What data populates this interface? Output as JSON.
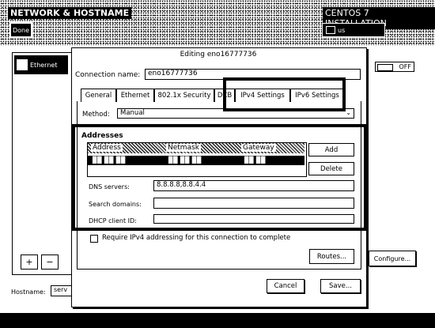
{
  "header": {
    "title": "NETWORK & HOSTNAME",
    "done_label": "Done",
    "product": "CENTOS 7 INSTALLATION",
    "keyboard_layout": "us"
  },
  "network": {
    "device_label": "Ethernet",
    "toggle_label": "OFF",
    "add_label": "+",
    "remove_label": "−",
    "configure_label": "Configure...",
    "hostname_label": "Hostname:",
    "hostname_value": "serv"
  },
  "dialog": {
    "title": "Editing eno16777736",
    "connection_name_label": "Connection name:",
    "connection_name_value": "eno16777736",
    "tabs": [
      "General",
      "Ethernet",
      "802.1x Security",
      "DCB",
      "IPv4 Settings",
      "IPv6 Settings"
    ],
    "method_label": "Method:",
    "method_value": "Manual",
    "addresses_title": "Addresses",
    "address_columns": [
      "Address",
      "Netmask",
      "Gateway"
    ],
    "address_row": [
      "▉▉  ▉▉  ▉▉",
      "▉▉  ▉▉  ▉▉",
      "▉▉  ▉▉"
    ],
    "add_label": "Add",
    "delete_label": "Delete",
    "dns_label": "DNS servers:",
    "dns_value": "8.8.8.8,8.8.4.4",
    "search_domains_label": "Search domains:",
    "dhcp_client_id_label": "DHCP client ID:",
    "require_ipv4_label": "Require IPv4 addressing for this connection to complete",
    "routes_label": "Routes...",
    "cancel_label": "Cancel",
    "save_label": "Save..."
  }
}
